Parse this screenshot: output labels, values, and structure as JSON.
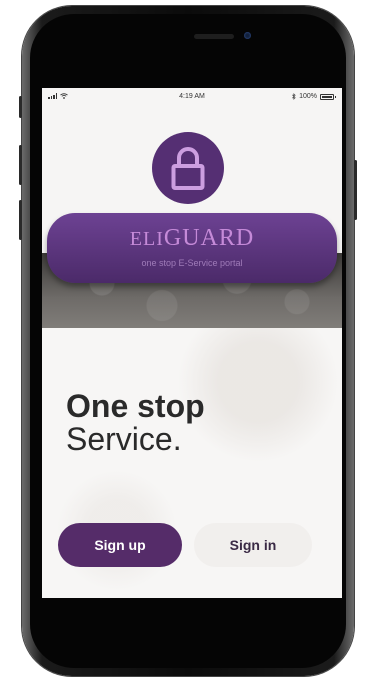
{
  "status_bar": {
    "time": "4:19 AM",
    "battery": "100%",
    "battery_level": 1.0
  },
  "app": {
    "brand_prefix": "ELI",
    "brand_suffix": "GUARD",
    "tagline": "one stop E-Service portal",
    "lock_icon": "lock-icon",
    "accent_color": "#552c69"
  },
  "headline": {
    "line1": "One stop",
    "line2": "Service."
  },
  "actions": {
    "signup_label": "Sign up",
    "signin_label": "Sign in"
  }
}
